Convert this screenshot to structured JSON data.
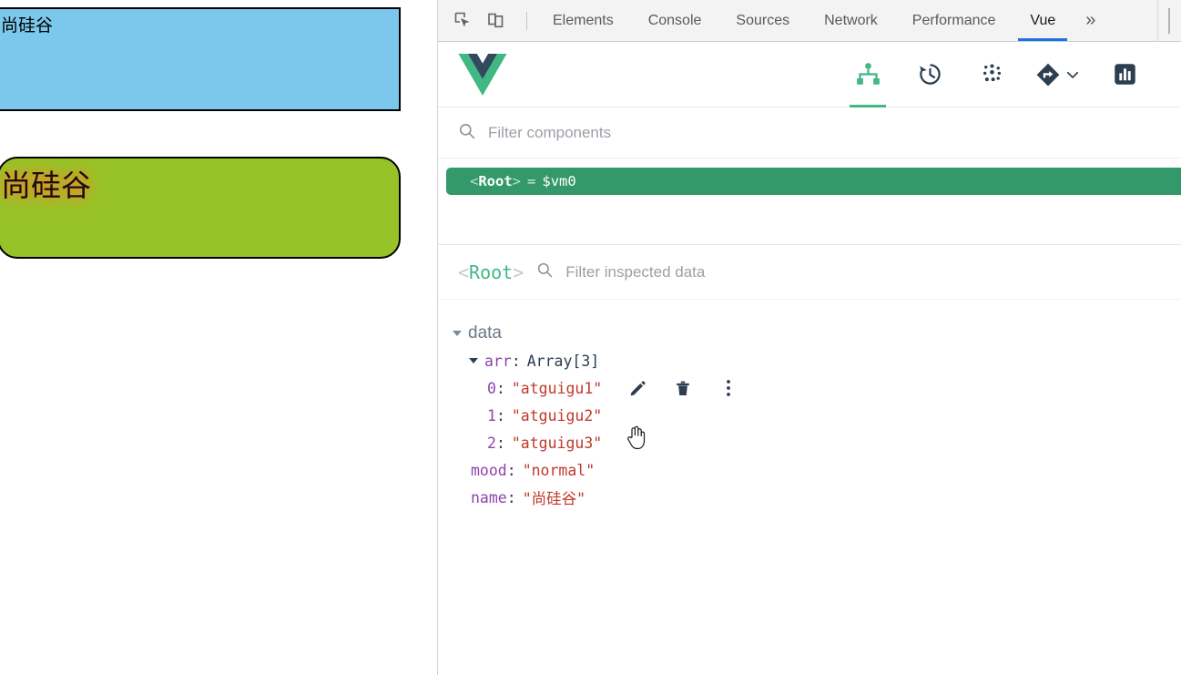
{
  "page": {
    "blue_box": {
      "text": "尚硅谷",
      "bg": "#7BC8EC",
      "border": "#000000"
    },
    "green_box": {
      "text": "尚硅谷",
      "bg": "#97C329",
      "glow": "#E8912A",
      "border": "#000000"
    }
  },
  "devtools": {
    "icons": {
      "inspect": "inspect-element-icon",
      "device": "device-toolbar-icon"
    },
    "tabs": [
      {
        "label": "Elements",
        "active": false
      },
      {
        "label": "Console",
        "active": false
      },
      {
        "label": "Sources",
        "active": false
      },
      {
        "label": "Network",
        "active": false
      },
      {
        "label": "Performance",
        "active": false
      },
      {
        "label": "Vue",
        "active": true
      }
    ],
    "more_tabs": "»",
    "active_tab_color": "#1a73e8"
  },
  "vue_panel": {
    "logo": "vue-logo",
    "logo_colors": {
      "outer": "#41B883",
      "inner": "#35495E"
    },
    "accent": "#42b883",
    "nav": [
      {
        "name": "component-tree-icon",
        "active": true
      },
      {
        "name": "timeline-history-icon",
        "active": false
      },
      {
        "name": "dots-grid-icon",
        "active": false
      },
      {
        "name": "routing-diamond-icon",
        "active": false,
        "has_chevron": true
      },
      {
        "name": "bar-chart-icon",
        "active": false
      }
    ],
    "filter": {
      "placeholder": "Filter components",
      "value": "",
      "icon": "search-icon"
    },
    "tree": {
      "selected_row": {
        "open_angle": "<",
        "name": "Root",
        "close_angle": ">",
        "equals": "=",
        "vm": "$vm0",
        "bg": "#34996a"
      }
    },
    "inspector": {
      "root_label_open": "<",
      "root_label": "Root",
      "root_label_close": ">",
      "filter": {
        "placeholder": "Filter inspected data",
        "value": "",
        "icon": "search-icon"
      },
      "group": "data",
      "rows": [
        {
          "level": 2,
          "caret": true,
          "key": "arr",
          "value": "Array[3]",
          "value_type": "type",
          "actions": false
        },
        {
          "level": 3,
          "caret": false,
          "key": "0",
          "value": "\"atguigu1\"",
          "value_type": "string",
          "actions": true
        },
        {
          "level": 3,
          "caret": false,
          "key": "1",
          "value": "\"atguigu2\"",
          "value_type": "string",
          "actions": false
        },
        {
          "level": 3,
          "caret": false,
          "key": "2",
          "value": "\"atguigu3\"",
          "value_type": "string",
          "actions": false
        },
        {
          "level": 2,
          "caret": false,
          "key": "mood",
          "value": "\"normal\"",
          "value_type": "string",
          "actions": false
        },
        {
          "level": 2,
          "caret": false,
          "key": "name",
          "value": "\"尚硅谷\"",
          "value_type": "string",
          "actions": false
        }
      ],
      "row_action_icons": [
        "edit-pencil-icon",
        "delete-trash-icon",
        "more-vertical-icon"
      ]
    }
  }
}
